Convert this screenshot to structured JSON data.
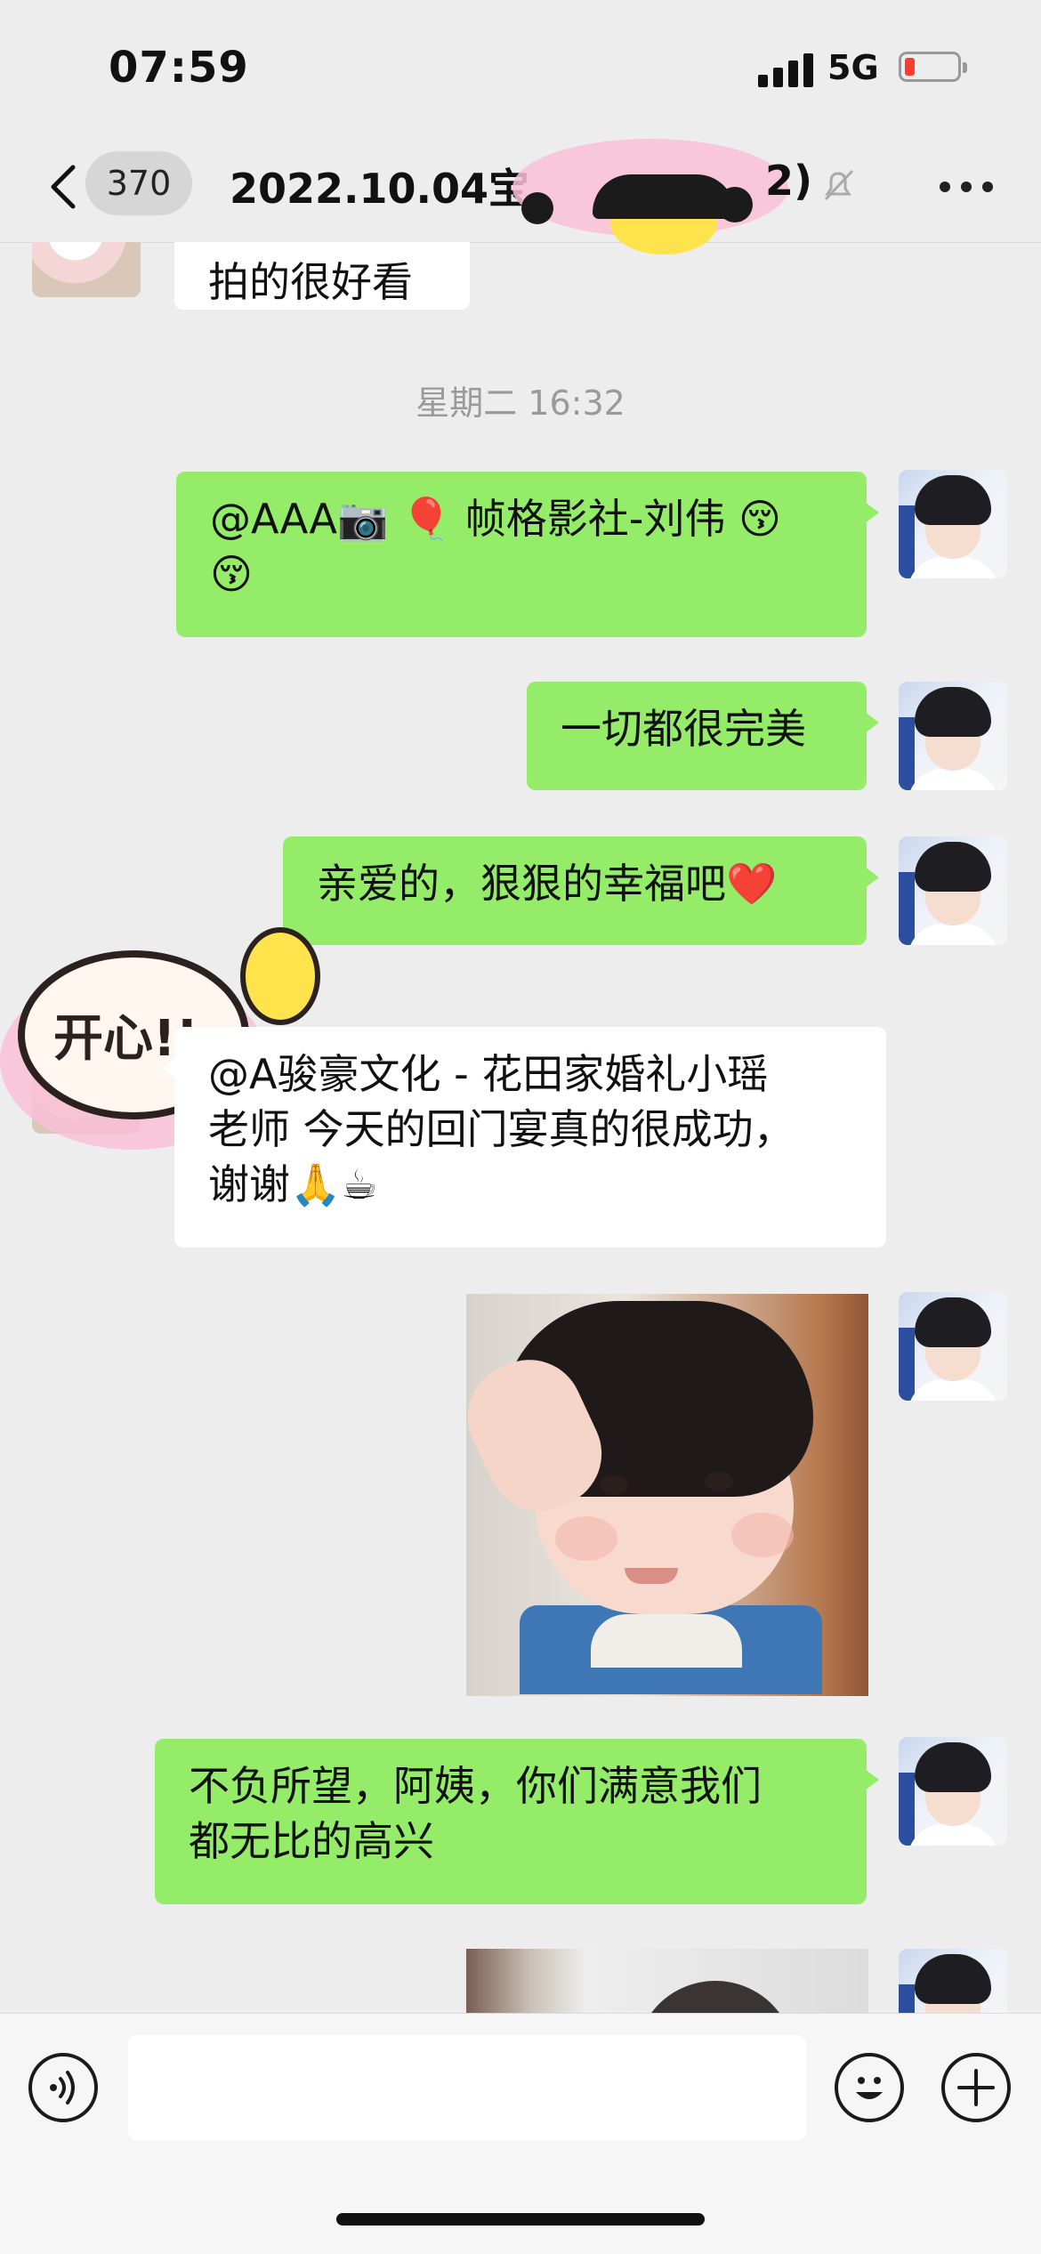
{
  "status_bar": {
    "time": "07:59",
    "network": "5G",
    "battery_color": "#ff3b30"
  },
  "header": {
    "unread_count": "370",
    "title": "2022.10.04宝",
    "title_suffix": "2)",
    "mute_icon": "bell-slash-icon",
    "more_icon": "more-dots-icon"
  },
  "chat": {
    "top_partial_message": "拍的很好看",
    "timestamp": "星期二 16:32",
    "messages": [
      {
        "sender": "me",
        "text": "@AAA📷 🎈 帧格影社-刘伟 😚",
        "text2": "😚"
      },
      {
        "sender": "me",
        "text": "一切都很完美"
      },
      {
        "sender": "me",
        "text": "亲爱的，狠狠的幸福吧❤️"
      },
      {
        "sender": "other",
        "line1": "@A骏豪文化 - 花田家婚礼小瑶",
        "line2": "老师 今天的回门宴真的很成功，",
        "line3": "谢谢🙏☕"
      },
      {
        "sender": "me",
        "type": "image",
        "description": "baby-saluting-sticker"
      },
      {
        "sender": "me",
        "line1": "不负所望，阿姨，你们满意我们",
        "line2": "都无比的高兴"
      },
      {
        "sender": "me",
        "type": "image",
        "description": "partial-photo"
      }
    ],
    "sticker_text": "开心!!"
  },
  "input_bar": {
    "voice_icon": "voice-icon",
    "emoji_icon": "emoji-face-icon",
    "plus_icon": "plus-icon"
  },
  "colors": {
    "my_bubble": "#95ec69",
    "other_bubble": "#ffffff",
    "background": "#ededed"
  }
}
